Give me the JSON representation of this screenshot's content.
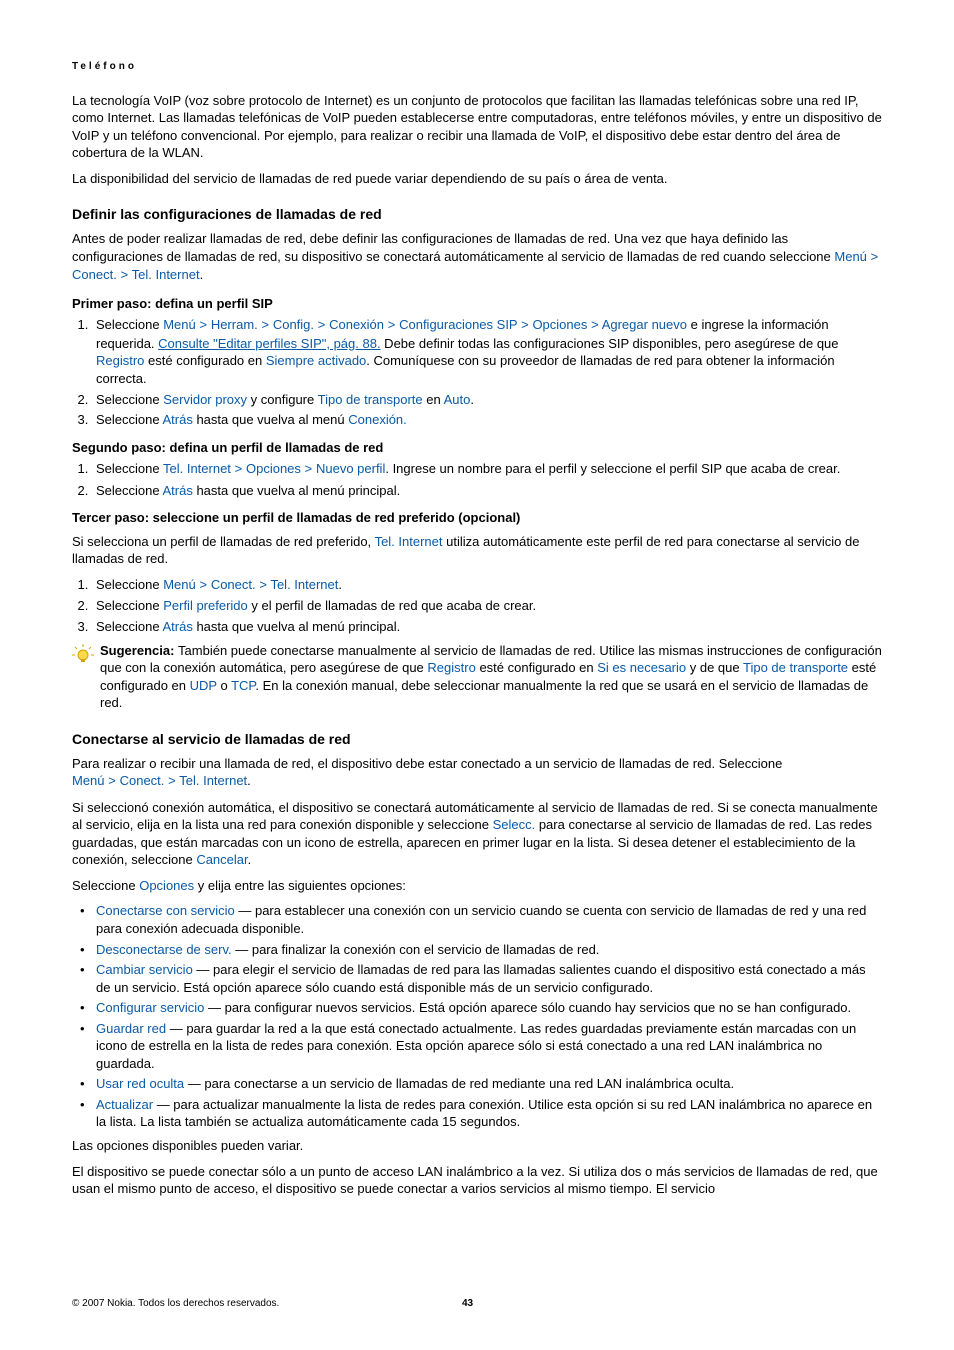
{
  "runningHeader": "Teléfono",
  "intro1": "La tecnología VoIP (voz sobre protocolo de Internet) es un conjunto de protocolos que facilitan las llamadas telefónicas sobre una red IP, como Internet. Las llamadas telefónicas de VoIP pueden establecerse entre computadoras, entre teléfonos móviles, y entre un dispositivo de VoIP y un teléfono convencional. Por ejemplo, para realizar o recibir una llamada de VoIP, el dispositivo debe estar dentro del área de cobertura de la WLAN.",
  "intro2": "La disponibilidad del servicio de llamadas de red puede variar dependiendo de su país o área de venta.",
  "sec1": {
    "title": "Definir las configuraciones de llamadas de red",
    "p1a": "Antes de poder realizar llamadas de red, debe definir las configuraciones de llamadas de red. Una vez que haya definido las configuraciones de llamadas de red, su dispositivo se conectará automáticamente al servicio de llamadas de red cuando seleccione ",
    "menu": {
      "m": "Menú",
      "c": "Conect.",
      "t": "Tel. Internet"
    },
    "step1h": "Primer paso: defina un perfil SIP",
    "s1_1a": "Seleccione ",
    "s1_1_path": {
      "m": "Menú",
      "h": "Herram.",
      "cf": "Config.",
      "cx": "Conexión",
      "sip": "Configuraciones SIP",
      "op": "Opciones",
      "an": "Agregar nuevo"
    },
    "s1_1b": " e ingrese la información requerida. ",
    "s1_1_link": "Consulte \"Editar perfiles SIP\", pág. 88.",
    "s1_1c": " Debe definir todas las configuraciones SIP disponibles, pero asegúrese de que ",
    "s1_1_reg": "Registro",
    "s1_1d": " esté configurado en ",
    "s1_1_sa": "Siempre activado",
    "s1_1e": ". Comuníquese con su proveedor de llamadas de red para obtener la información correcta.",
    "s1_2a": "Seleccione ",
    "s1_2_sp": "Servidor proxy",
    "s1_2b": " y configure ",
    "s1_2_tt": "Tipo de transporte",
    "s1_2c": " en ",
    "s1_2_auto": "Auto",
    "s1_2d": ".",
    "s1_3a": "Seleccione ",
    "s1_3_atras": "Atrás",
    "s1_3b": " hasta que vuelva al menú ",
    "s1_3_cx": "Conexión.",
    "step2h": "Segundo paso: defina un perfil de llamadas de red",
    "s2_1a": "Seleccione ",
    "s2_1_path": {
      "t": "Tel. Internet",
      "op": "Opciones",
      "np": "Nuevo perfil"
    },
    "s2_1b": ". Ingrese un nombre para el perfil y seleccione el perfil SIP que acaba de crear.",
    "s2_2a": "Seleccione ",
    "s2_2_atras": "Atrás",
    "s2_2b": " hasta que vuelva al menú principal.",
    "step3h": "Tercer paso: seleccione un perfil de llamadas de red preferido (opcional)",
    "s3_p_a": "Si selecciona un perfil de llamadas de red preferido, ",
    "s3_p_ti": "Tel. Internet",
    "s3_p_b": " utiliza automáticamente este perfil de red para conectarse al servicio de llamadas de red.",
    "s3_1a": "Seleccione ",
    "s3_2a": "Seleccione ",
    "s3_2_pp": "Perfil preferido",
    "s3_2b": " y el perfil de llamadas de red que acaba de crear.",
    "s3_3a": "Seleccione ",
    "s3_3_atras": "Atrás",
    "s3_3b": " hasta que vuelva al menú principal.",
    "tip_label": "Sugerencia: ",
    "tip_a": "También puede conectarse manualmente al servicio de llamadas de red. Utilice las mismas instrucciones de configuración que con la conexión automática, pero asegúrese de que ",
    "tip_reg": "Registro",
    "tip_b": " esté configurado en ",
    "tip_sies": "Si es necesario",
    "tip_c": " y de que ",
    "tip_tt": "Tipo de transporte",
    "tip_d": " esté configurado en ",
    "tip_udp": "UDP",
    "tip_or": " o ",
    "tip_tcp": "TCP",
    "tip_e": ". En la conexión manual, debe seleccionar manualmente la red que se usará en el servicio de llamadas de red."
  },
  "sec2": {
    "title": "Conectarse al servicio de llamadas de red",
    "p1a": "Para realizar o recibir una llamada de red, el dispositivo debe estar conectado a un servicio de llamadas de red. Seleccione ",
    "p2a": "Si seleccionó conexión automática, el dispositivo se conectará automáticamente al servicio de llamadas de red. Si se conecta manualmente al servicio, elija en la lista una red para conexión disponible y seleccione ",
    "selecc": "Selecc.",
    "p2b": " para conectarse al servicio de llamadas de red. Las redes guardadas, que están marcadas con un icono de estrella, aparecen en primer lugar en la lista. Si desea detener el establecimiento de la conexión, seleccione ",
    "cancelar": "Cancelar",
    "p2c": ".",
    "p3a": "Seleccione ",
    "opciones": "Opciones",
    "p3b": " y elija entre las siguientes opciones:",
    "opts": [
      {
        "k": "Conectarse con servicio",
        "t": "  — para establecer una conexión con un servicio cuando se cuenta con servicio de llamadas de red y una red para conexión adecuada disponible."
      },
      {
        "k": "Desconectarse de serv.",
        "t": " — para finalizar la conexión con el servicio de llamadas de red."
      },
      {
        "k": "Cambiar servicio",
        "t": " — para elegir el servicio de llamadas de red para las llamadas salientes cuando el dispositivo está conectado a más de un servicio. Está opción aparece sólo cuando está disponible más de un servicio configurado."
      },
      {
        "k": "Configurar servicio",
        "t": " — para configurar nuevos servicios. Está opción aparece sólo cuando hay servicios que no se han configurado."
      },
      {
        "k": "Guardar red",
        "t": " — para guardar la red a la que está conectado actualmente. Las redes guardadas previamente están marcadas con un icono de estrella en la lista de redes para conexión. Esta opción aparece sólo si está conectado a una red LAN inalámbrica no guardada."
      },
      {
        "k": "Usar red oculta",
        "t": " — para conectarse a un servicio de llamadas de red mediante una red LAN inalámbrica oculta."
      },
      {
        "k": "Actualizar",
        "t": " — para actualizar manualmente la lista de redes para conexión. Utilice esta opción si su red LAN inalámbrica no aparece en la lista. La lista también se actualiza automáticamente cada 15 segundos."
      }
    ],
    "p4": "Las opciones disponibles pueden variar.",
    "p5": "El dispositivo se puede conectar sólo a un punto de acceso LAN inalámbrico a la vez. Si utiliza dos o más servicios de llamadas de red, que usan el mismo punto de acceso, el dispositivo se puede conectar a varios servicios al mismo tiempo. El servicio"
  },
  "footer": {
    "copyright": "© 2007 Nokia. Todos los derechos reservados.",
    "page": "43"
  },
  "gtChar": ">"
}
